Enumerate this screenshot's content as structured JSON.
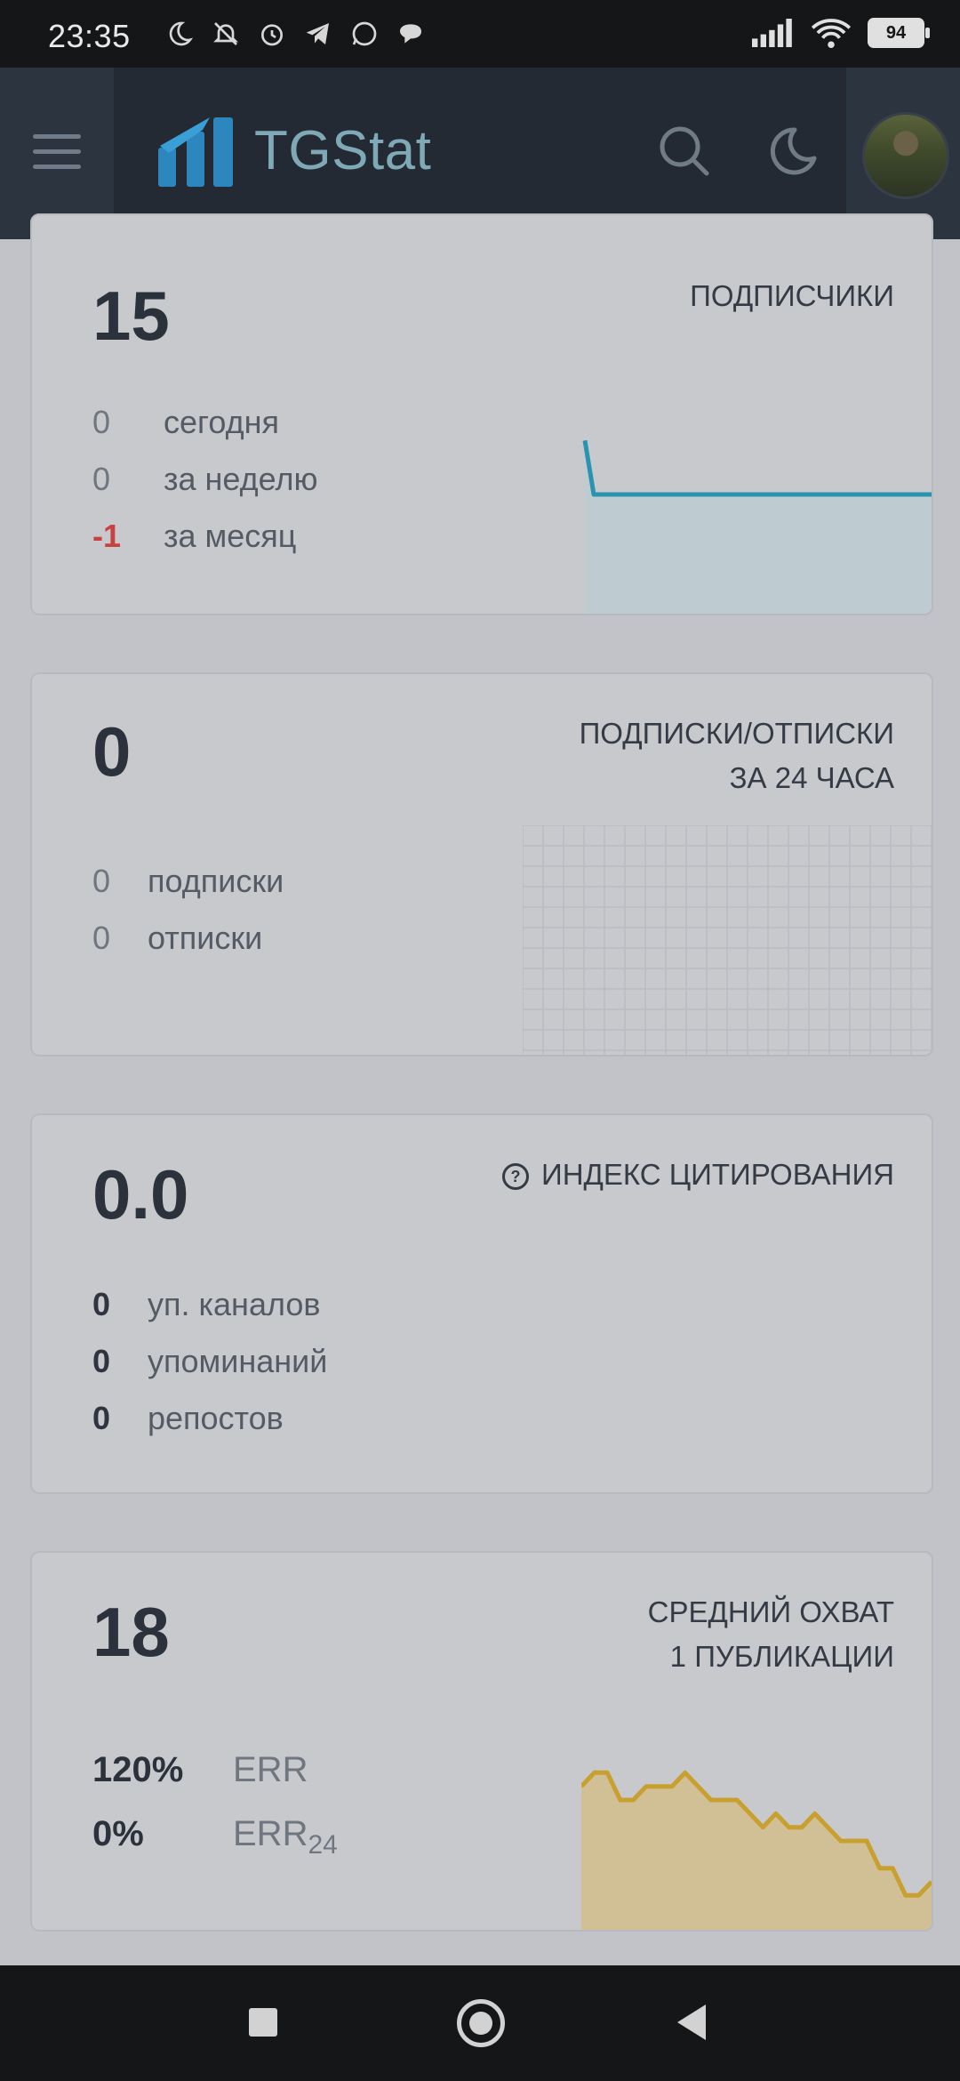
{
  "status_bar": {
    "time": "23:35",
    "battery": "94",
    "icons": [
      "moon-icon",
      "bell-off-icon",
      "alarm-icon",
      "telegram-icon",
      "whatsapp-icon",
      "chat-icon",
      "signal-icon",
      "wifi-icon",
      "battery-icon"
    ]
  },
  "header": {
    "brand": "TGStat",
    "icons": [
      "menu-icon",
      "logo-icon",
      "search-icon",
      "moon-icon",
      "avatar"
    ]
  },
  "cards": {
    "subscribers": {
      "value": "15",
      "title": "ПОДПИСЧИКИ",
      "rows": [
        {
          "value": "0",
          "label": "сегодня"
        },
        {
          "value": "0",
          "label": "за неделю"
        },
        {
          "value": "-1",
          "label": "за месяц"
        }
      ]
    },
    "subs24": {
      "value": "0",
      "title_line1": "ПОДПИСКИ/ОТПИСКИ",
      "title_line2": "ЗА 24 ЧАСА",
      "rows": [
        {
          "value": "0",
          "label": "подписки"
        },
        {
          "value": "0",
          "label": "отписки"
        }
      ]
    },
    "citation": {
      "value": "0.0",
      "title": "ИНДЕКС ЦИТИРОВАНИЯ",
      "help_symbol": "?",
      "rows": [
        {
          "value": "0",
          "label": "уп. каналов"
        },
        {
          "value": "0",
          "label": "упоминаний"
        },
        {
          "value": "0",
          "label": "репостов"
        }
      ]
    },
    "reach": {
      "value": "18",
      "title_line1": "СРЕДНИЙ ОХВАТ",
      "title_line2": "1 ПУБЛИКАЦИИ",
      "err": {
        "value": "120%",
        "label": "ERR"
      },
      "err24": {
        "value": "0%",
        "label": "ERR",
        "sub": "24"
      }
    }
  },
  "chart_data": [
    {
      "type": "line",
      "name": "subscribers-sparkline",
      "color": "#2a93b0",
      "values": [
        22,
        15,
        15,
        15,
        15,
        15,
        15,
        15,
        15,
        15,
        15,
        15,
        15,
        15,
        15,
        15,
        15,
        15,
        15,
        15,
        15,
        15,
        15,
        15,
        15,
        15,
        15,
        15,
        15,
        15,
        15
      ]
    },
    {
      "type": "area",
      "name": "reach-sparkline",
      "color": "#c8a030",
      "values": [
        20,
        21,
        21,
        19,
        19,
        20,
        20,
        20,
        21,
        20,
        19,
        19,
        19,
        18,
        17,
        18,
        17,
        17,
        18,
        17,
        16,
        16,
        16,
        14,
        14,
        12,
        12,
        13
      ]
    }
  ]
}
